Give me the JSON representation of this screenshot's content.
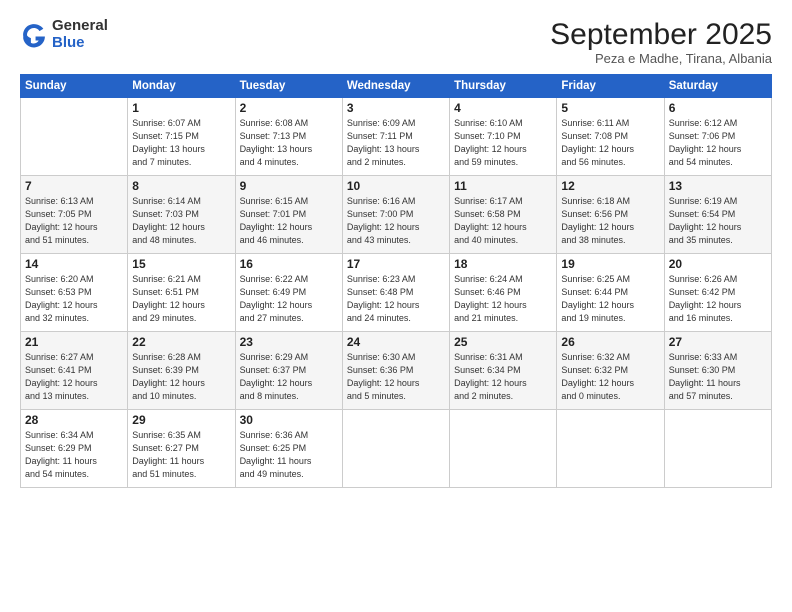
{
  "logo": {
    "general": "General",
    "blue": "Blue"
  },
  "header": {
    "month": "September 2025",
    "location": "Peza e Madhe, Tirana, Albania"
  },
  "days_of_week": [
    "Sunday",
    "Monday",
    "Tuesday",
    "Wednesday",
    "Thursday",
    "Friday",
    "Saturday"
  ],
  "weeks": [
    [
      {
        "day": "",
        "details": ""
      },
      {
        "day": "1",
        "details": "Sunrise: 6:07 AM\nSunset: 7:15 PM\nDaylight: 13 hours\nand 7 minutes."
      },
      {
        "day": "2",
        "details": "Sunrise: 6:08 AM\nSunset: 7:13 PM\nDaylight: 13 hours\nand 4 minutes."
      },
      {
        "day": "3",
        "details": "Sunrise: 6:09 AM\nSunset: 7:11 PM\nDaylight: 13 hours\nand 2 minutes."
      },
      {
        "day": "4",
        "details": "Sunrise: 6:10 AM\nSunset: 7:10 PM\nDaylight: 12 hours\nand 59 minutes."
      },
      {
        "day": "5",
        "details": "Sunrise: 6:11 AM\nSunset: 7:08 PM\nDaylight: 12 hours\nand 56 minutes."
      },
      {
        "day": "6",
        "details": "Sunrise: 6:12 AM\nSunset: 7:06 PM\nDaylight: 12 hours\nand 54 minutes."
      }
    ],
    [
      {
        "day": "7",
        "details": "Sunrise: 6:13 AM\nSunset: 7:05 PM\nDaylight: 12 hours\nand 51 minutes."
      },
      {
        "day": "8",
        "details": "Sunrise: 6:14 AM\nSunset: 7:03 PM\nDaylight: 12 hours\nand 48 minutes."
      },
      {
        "day": "9",
        "details": "Sunrise: 6:15 AM\nSunset: 7:01 PM\nDaylight: 12 hours\nand 46 minutes."
      },
      {
        "day": "10",
        "details": "Sunrise: 6:16 AM\nSunset: 7:00 PM\nDaylight: 12 hours\nand 43 minutes."
      },
      {
        "day": "11",
        "details": "Sunrise: 6:17 AM\nSunset: 6:58 PM\nDaylight: 12 hours\nand 40 minutes."
      },
      {
        "day": "12",
        "details": "Sunrise: 6:18 AM\nSunset: 6:56 PM\nDaylight: 12 hours\nand 38 minutes."
      },
      {
        "day": "13",
        "details": "Sunrise: 6:19 AM\nSunset: 6:54 PM\nDaylight: 12 hours\nand 35 minutes."
      }
    ],
    [
      {
        "day": "14",
        "details": "Sunrise: 6:20 AM\nSunset: 6:53 PM\nDaylight: 12 hours\nand 32 minutes."
      },
      {
        "day": "15",
        "details": "Sunrise: 6:21 AM\nSunset: 6:51 PM\nDaylight: 12 hours\nand 29 minutes."
      },
      {
        "day": "16",
        "details": "Sunrise: 6:22 AM\nSunset: 6:49 PM\nDaylight: 12 hours\nand 27 minutes."
      },
      {
        "day": "17",
        "details": "Sunrise: 6:23 AM\nSunset: 6:48 PM\nDaylight: 12 hours\nand 24 minutes."
      },
      {
        "day": "18",
        "details": "Sunrise: 6:24 AM\nSunset: 6:46 PM\nDaylight: 12 hours\nand 21 minutes."
      },
      {
        "day": "19",
        "details": "Sunrise: 6:25 AM\nSunset: 6:44 PM\nDaylight: 12 hours\nand 19 minutes."
      },
      {
        "day": "20",
        "details": "Sunrise: 6:26 AM\nSunset: 6:42 PM\nDaylight: 12 hours\nand 16 minutes."
      }
    ],
    [
      {
        "day": "21",
        "details": "Sunrise: 6:27 AM\nSunset: 6:41 PM\nDaylight: 12 hours\nand 13 minutes."
      },
      {
        "day": "22",
        "details": "Sunrise: 6:28 AM\nSunset: 6:39 PM\nDaylight: 12 hours\nand 10 minutes."
      },
      {
        "day": "23",
        "details": "Sunrise: 6:29 AM\nSunset: 6:37 PM\nDaylight: 12 hours\nand 8 minutes."
      },
      {
        "day": "24",
        "details": "Sunrise: 6:30 AM\nSunset: 6:36 PM\nDaylight: 12 hours\nand 5 minutes."
      },
      {
        "day": "25",
        "details": "Sunrise: 6:31 AM\nSunset: 6:34 PM\nDaylight: 12 hours\nand 2 minutes."
      },
      {
        "day": "26",
        "details": "Sunrise: 6:32 AM\nSunset: 6:32 PM\nDaylight: 12 hours\nand 0 minutes."
      },
      {
        "day": "27",
        "details": "Sunrise: 6:33 AM\nSunset: 6:30 PM\nDaylight: 11 hours\nand 57 minutes."
      }
    ],
    [
      {
        "day": "28",
        "details": "Sunrise: 6:34 AM\nSunset: 6:29 PM\nDaylight: 11 hours\nand 54 minutes."
      },
      {
        "day": "29",
        "details": "Sunrise: 6:35 AM\nSunset: 6:27 PM\nDaylight: 11 hours\nand 51 minutes."
      },
      {
        "day": "30",
        "details": "Sunrise: 6:36 AM\nSunset: 6:25 PM\nDaylight: 11 hours\nand 49 minutes."
      },
      {
        "day": "",
        "details": ""
      },
      {
        "day": "",
        "details": ""
      },
      {
        "day": "",
        "details": ""
      },
      {
        "day": "",
        "details": ""
      }
    ]
  ]
}
